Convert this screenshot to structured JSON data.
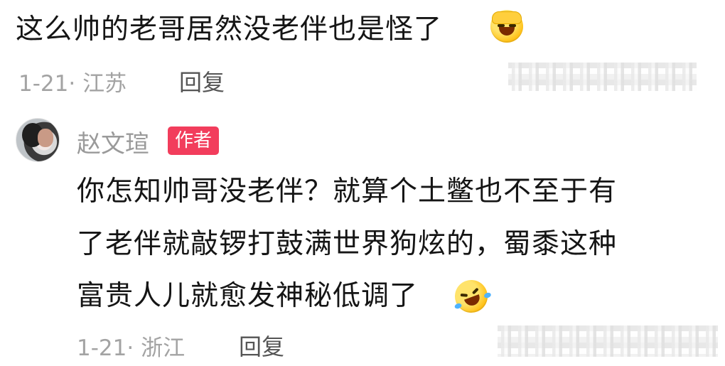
{
  "comment1": {
    "text": "这么帅的老哥居然没老伴也是怪了",
    "meta": "1-21· 江苏",
    "reply_label": "回复",
    "emoji": "facepalm-laughing-emoji"
  },
  "comment2": {
    "author": "赵文瑄",
    "author_badge": "作者",
    "lines": [
      "你怎知帅哥没老伴？就算个土鳖也不至于有",
      "了老伴就敲锣打鼓满世界狗炫的，蜀黍这种",
      "富贵人儿就愈发神秘低调了"
    ],
    "meta": "1-21· 浙江",
    "reply_label": "回复",
    "emoji": "rolling-on-floor-laughing-emoji"
  },
  "colors": {
    "badge": "#f23d5c",
    "meta_text": "#a3a3a3",
    "author_text": "#9a9a9a"
  }
}
